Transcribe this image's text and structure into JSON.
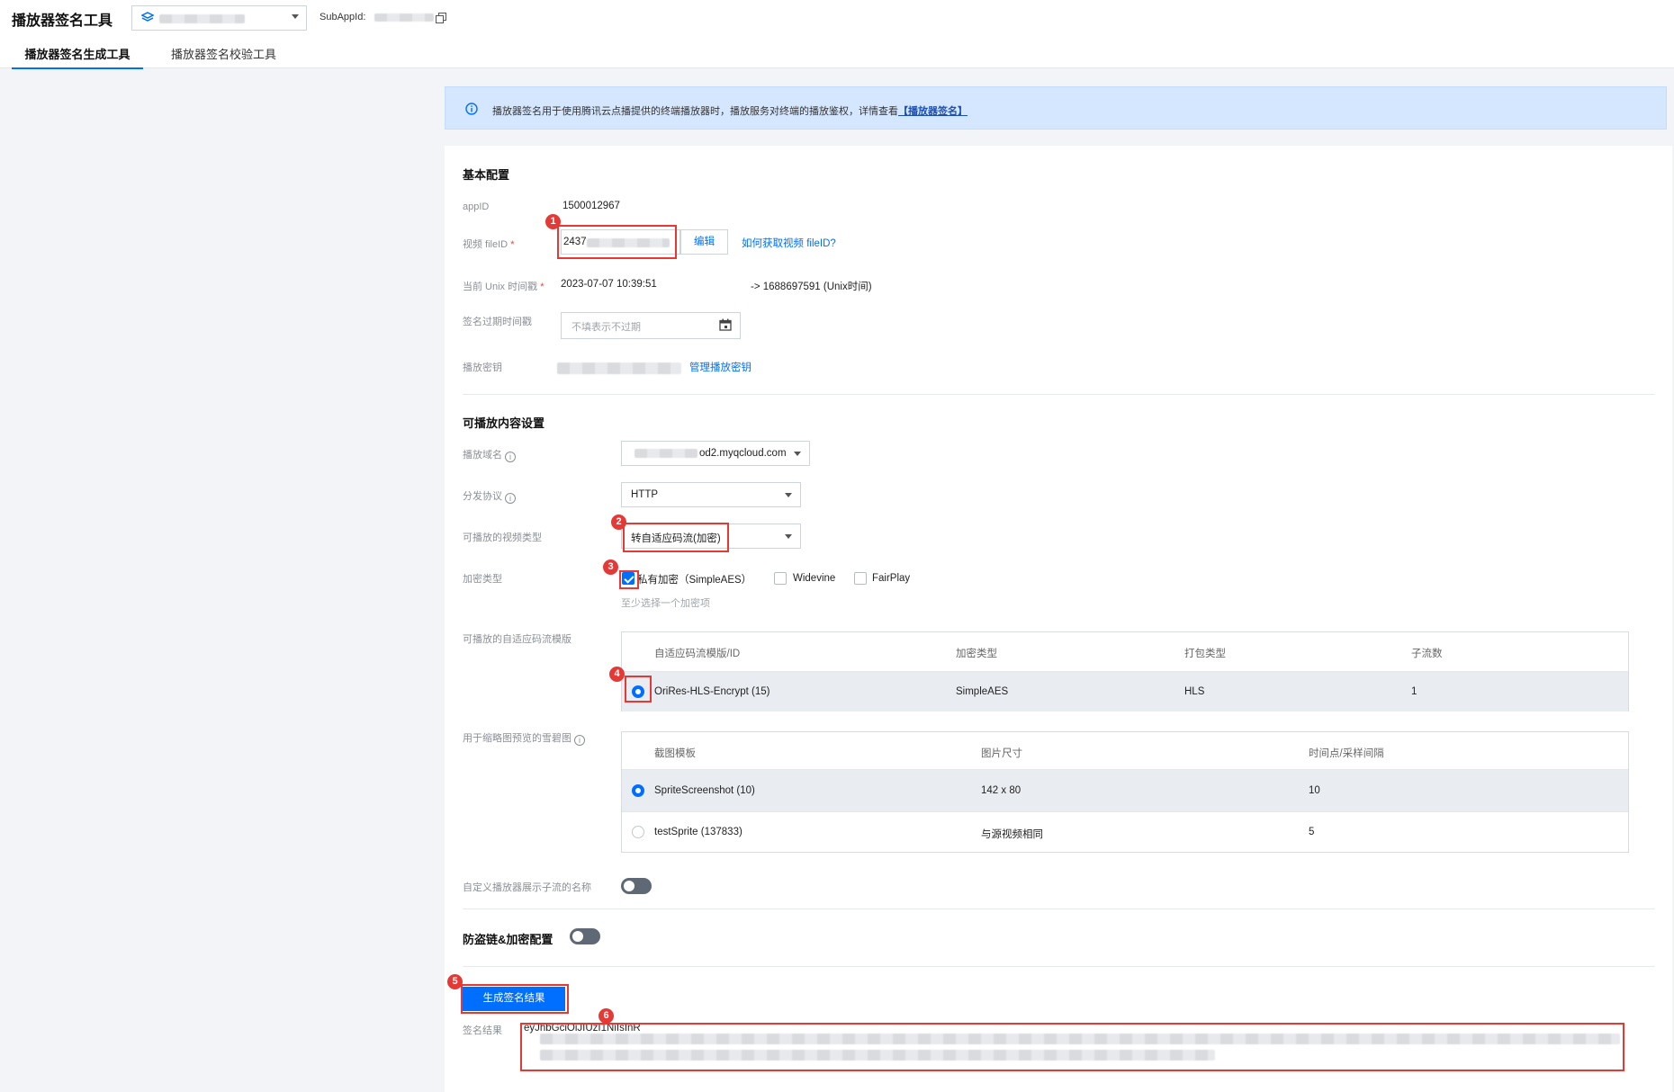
{
  "header": {
    "app_title": "播放器签名工具",
    "subappid_label": "SubAppId:",
    "tabs": [
      {
        "label": "播放器签名生成工具"
      },
      {
        "label": "播放器签名校验工具"
      }
    ]
  },
  "banner": {
    "text": "播放器签名用于使用腾讯云点播提供的终端播放器时，播放服务对终端的播放鉴权，详情查看",
    "link": "【播放器签名】"
  },
  "basic": {
    "title": "基本配置",
    "appid_label": "appID",
    "appid_value": "1500012967",
    "fileid_label": "视频 fileID",
    "fileid_required": "*",
    "fileid_value": "2437",
    "edit_button": "编辑",
    "fileid_help": "如何获取视频 fileID?",
    "unix_label": "当前 Unix 时间戳",
    "unix_required": "*",
    "unix_datetime": "2023-07-07 10:39:51",
    "unix_value": "-> 1688697591 (Unix时间)",
    "expire_label": "签名过期时间戳",
    "expire_placeholder": "不填表示不过期",
    "key_label": "播放密钥",
    "key_manage": "管理播放密钥"
  },
  "playable": {
    "title": "可播放内容设置",
    "domain_label": "播放域名",
    "domain_value": "od2.myqcloud.com",
    "protocol_label": "分发协议",
    "protocol_value": "HTTP",
    "video_type_label": "可播放的视频类型",
    "video_type_value": "转自适应码流(加密)",
    "encrypt_label": "加密类型",
    "encrypt_options": [
      {
        "label": "私有加密（SimpleAES）",
        "checked": true
      },
      {
        "label": "Widevine",
        "checked": false
      },
      {
        "label": "FairPlay",
        "checked": false
      }
    ],
    "encrypt_hint": "至少选择一个加密项",
    "template_label": "可播放的自适应码流模版",
    "template_headers": [
      "自适应码流模版/ID",
      "加密类型",
      "打包类型",
      "子流数"
    ],
    "template_rows": [
      {
        "name": "OriRes-HLS-Encrypt (15)",
        "encrypt": "SimpleAES",
        "pack": "HLS",
        "streams": "1",
        "selected": true
      }
    ],
    "sprite_label": "用于缩略图预览的雪碧图",
    "sprite_headers": [
      "截图模板",
      "图片尺寸",
      "时间点/采样间隔"
    ],
    "sprite_rows": [
      {
        "name": "SpriteScreenshot (10)",
        "size": "142 x 80",
        "interval": "10",
        "selected": true
      },
      {
        "name": "testSprite (137833)",
        "size": "与源视频相同",
        "interval": "5",
        "selected": false
      }
    ],
    "custom_name_label": "自定义播放器展示子流的名称"
  },
  "security": {
    "title": "防盗链&加密配置"
  },
  "result": {
    "generate_button": "生成签名结果",
    "label": "签名结果",
    "value_prefix": "eyJhbGciOiJIUzI1NiIsInR"
  },
  "annotations": [
    "1",
    "2",
    "3",
    "4",
    "5",
    "6"
  ],
  "colors": {
    "accent": "#006eff",
    "highlight": "#e53935",
    "banner_bg": "#d5e7ff"
  }
}
